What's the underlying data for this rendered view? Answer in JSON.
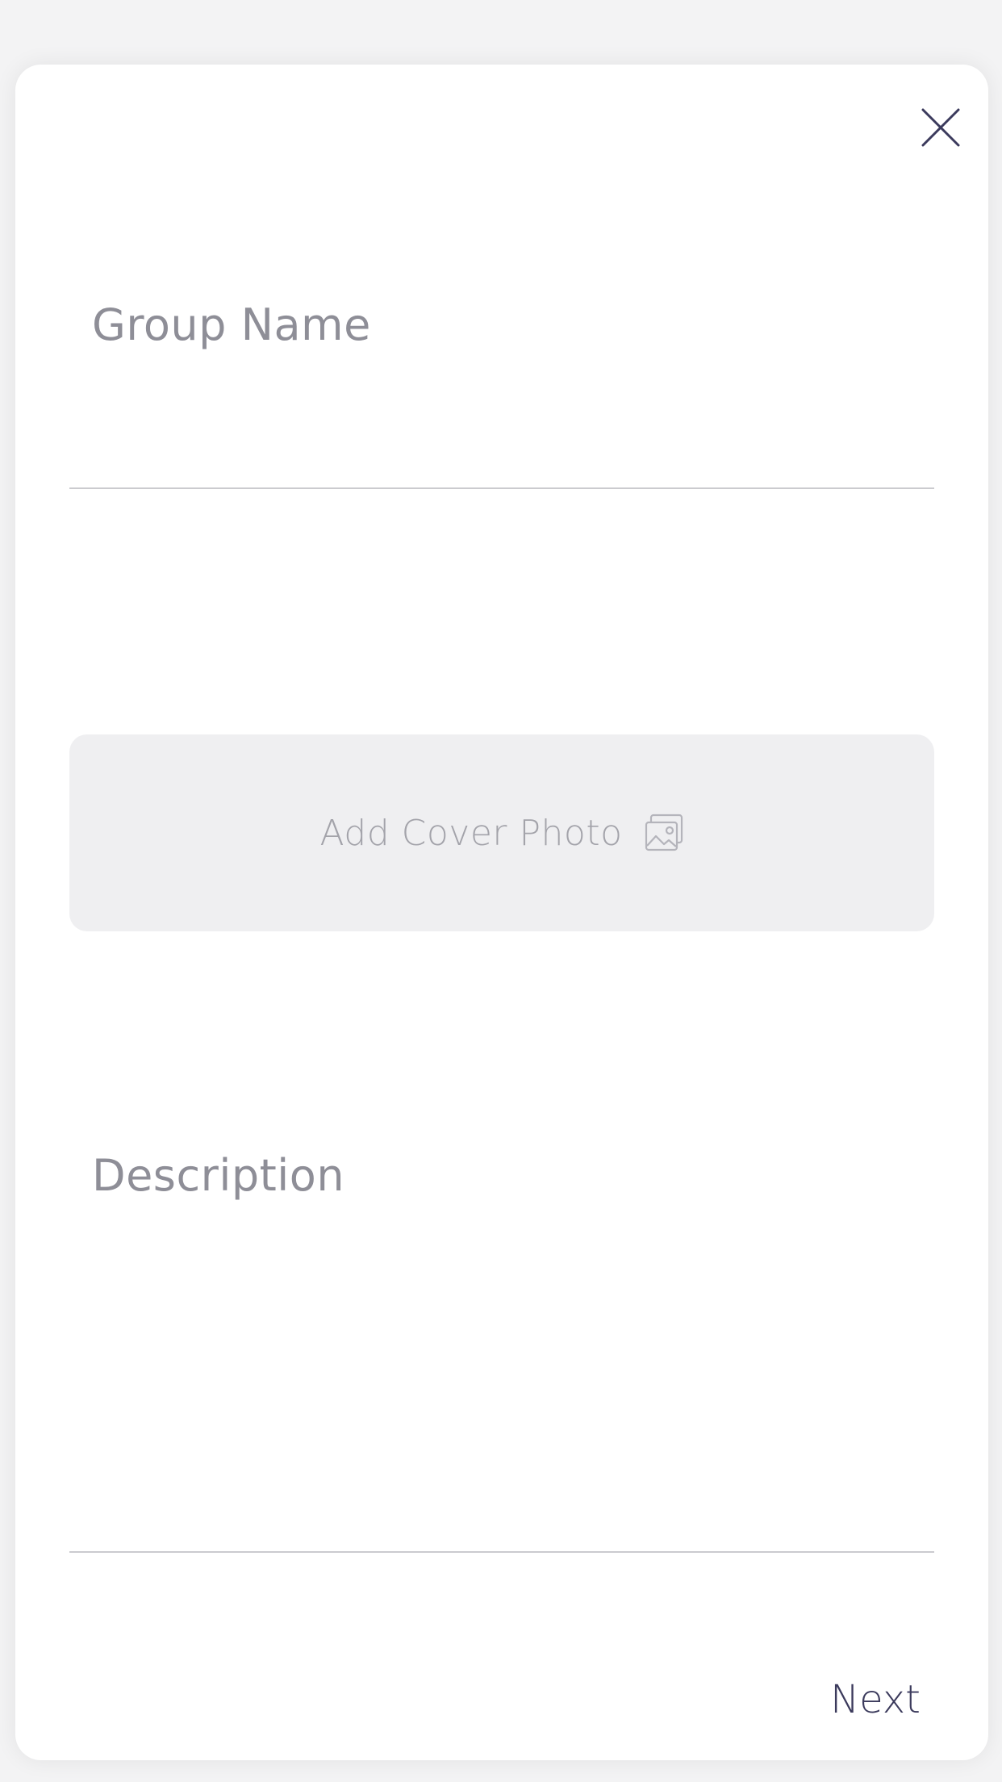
{
  "modal": {
    "close": {
      "icon": "close-icon"
    },
    "group_name": {
      "placeholder": "Group Name"
    },
    "cover_photo": {
      "label": "Add Cover Photo",
      "icon": "image-icon"
    },
    "description": {
      "placeholder": "Description"
    },
    "next_label": "Next"
  },
  "colors": {
    "background": "#f3f3f4",
    "card": "#ffffff",
    "placeholder": "#8e8e97",
    "accent": "#3b3a5c",
    "cover_bg": "#efeff1"
  }
}
